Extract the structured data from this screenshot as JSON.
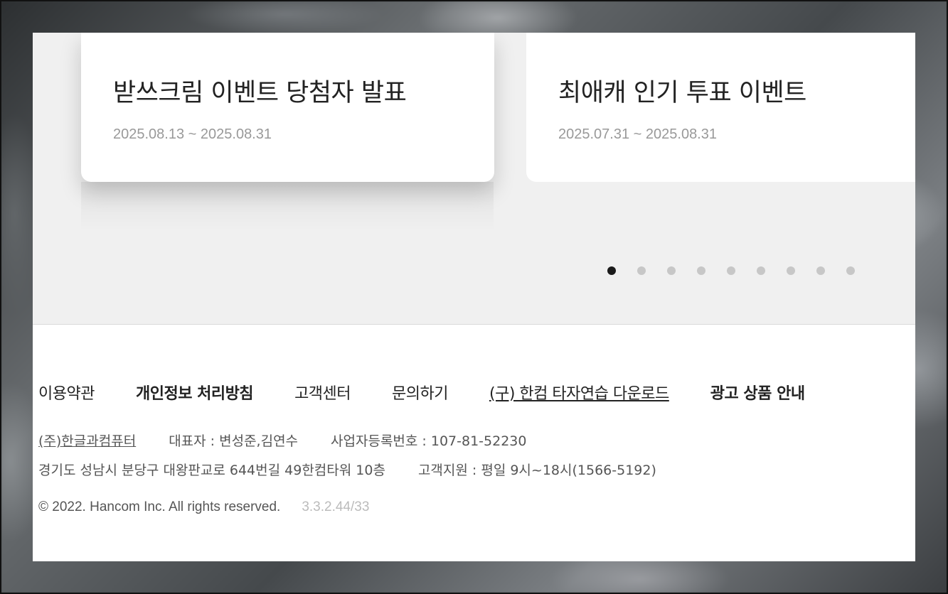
{
  "events": [
    {
      "title": "받쓰크림 이벤트 당첨자 발표",
      "date": "2025.08.13 ~ 2025.08.31"
    },
    {
      "title": "최애캐 인기 투표 이벤트",
      "date": "2025.07.31 ~ 2025.08.31"
    }
  ],
  "pagination": {
    "total": 9,
    "active_index": 0
  },
  "footer": {
    "links": [
      {
        "label": "이용약관"
      },
      {
        "label": "개인정보 처리방침"
      },
      {
        "label": "고객센터"
      },
      {
        "label": "문의하기"
      },
      {
        "label": "(구) 한컴 타자연습 다운로드"
      },
      {
        "label": "광고 상품 안내"
      }
    ],
    "company": "(주)한글과컴퓨터",
    "ceo": "대표자 : 변성준,김연수",
    "business_number": "사업자등록번호 : 107-81-52230",
    "address": "경기도 성남시 분당구 대왕판교로 644번길 49한컴타워 10층",
    "support": "고객지원 : 평일 9시~18시(1566-5192)",
    "copyright": "© 2022. Hancom Inc. All rights reserved.",
    "version": "3.3.2.44/33"
  }
}
